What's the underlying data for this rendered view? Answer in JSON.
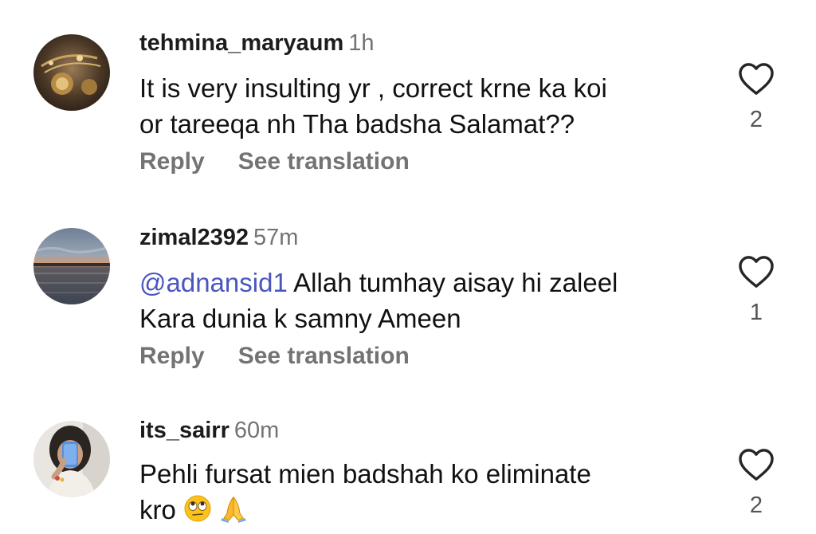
{
  "comments": [
    {
      "username": "tehmina_maryaum",
      "time": "1h",
      "text_lines": [
        "It is very insulting yr , correct krne ka koi",
        "or tareeqa nh Tha badsha Salamat??"
      ],
      "likes": "2",
      "avatar": "jewelry-photo"
    },
    {
      "username": "zimal2392",
      "time": "57m",
      "mention": "@adnansid1",
      "text_rest": "Allah tumhay aisay hi zaleel",
      "text_line2": "Kara dunia k samny Ameen",
      "likes": "1",
      "avatar": "sunset-lake-photo"
    },
    {
      "username": "its_sairr",
      "time": "60m",
      "text_lines": [
        "Pehli fursat mien badshah ko eliminate",
        "kro"
      ],
      "emojis": [
        "face-with-rolling-eyes",
        "folded-hands"
      ],
      "likes": "2",
      "avatar": "mirror-selfie-photo"
    }
  ],
  "actions": {
    "reply_label": "Reply",
    "translate_label": "See translation"
  },
  "icons": {
    "like": "heart-outline-icon"
  },
  "colors": {
    "mention": "#4a56c0",
    "secondary_text": "#737373"
  }
}
